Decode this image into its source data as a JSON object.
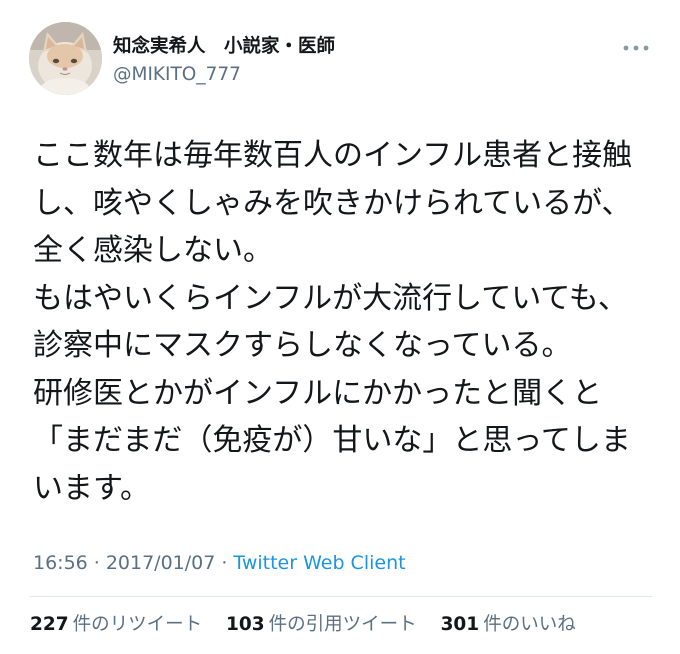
{
  "user": {
    "display_name": "知念実希人　小説家・医師",
    "handle": "@MIKITO_777",
    "avatar_icon": "cat-avatar-image"
  },
  "more_icon": "more-horizontal-icon",
  "tweet": {
    "lines": [
      "ここ数年は毎年数百人のインフル患者と接触",
      "し、咳やくしゃみを吹きかけられているが、",
      "全く感染しない。",
      "もはやいくらインフルが大流行していても、",
      "診察中にマスクすらしなくなっている。",
      "研修医とかがインフルにかかったと聞くと",
      "「まだまだ（免疫が）甘いな」と思ってしま",
      "います。"
    ]
  },
  "meta": {
    "time": "16:56",
    "separator": "·",
    "date": "2017/01/07",
    "source": "Twitter Web Client"
  },
  "stats": [
    {
      "count": "227",
      "label": "件のリツイート"
    },
    {
      "count": "103",
      "label": "件の引用ツイート"
    },
    {
      "count": "301",
      "label": "件のいいね"
    }
  ],
  "colors": {
    "text": "#14171a",
    "secondary": "#5b7083",
    "link": "#1b95e0",
    "divider": "#e1e8ed"
  }
}
